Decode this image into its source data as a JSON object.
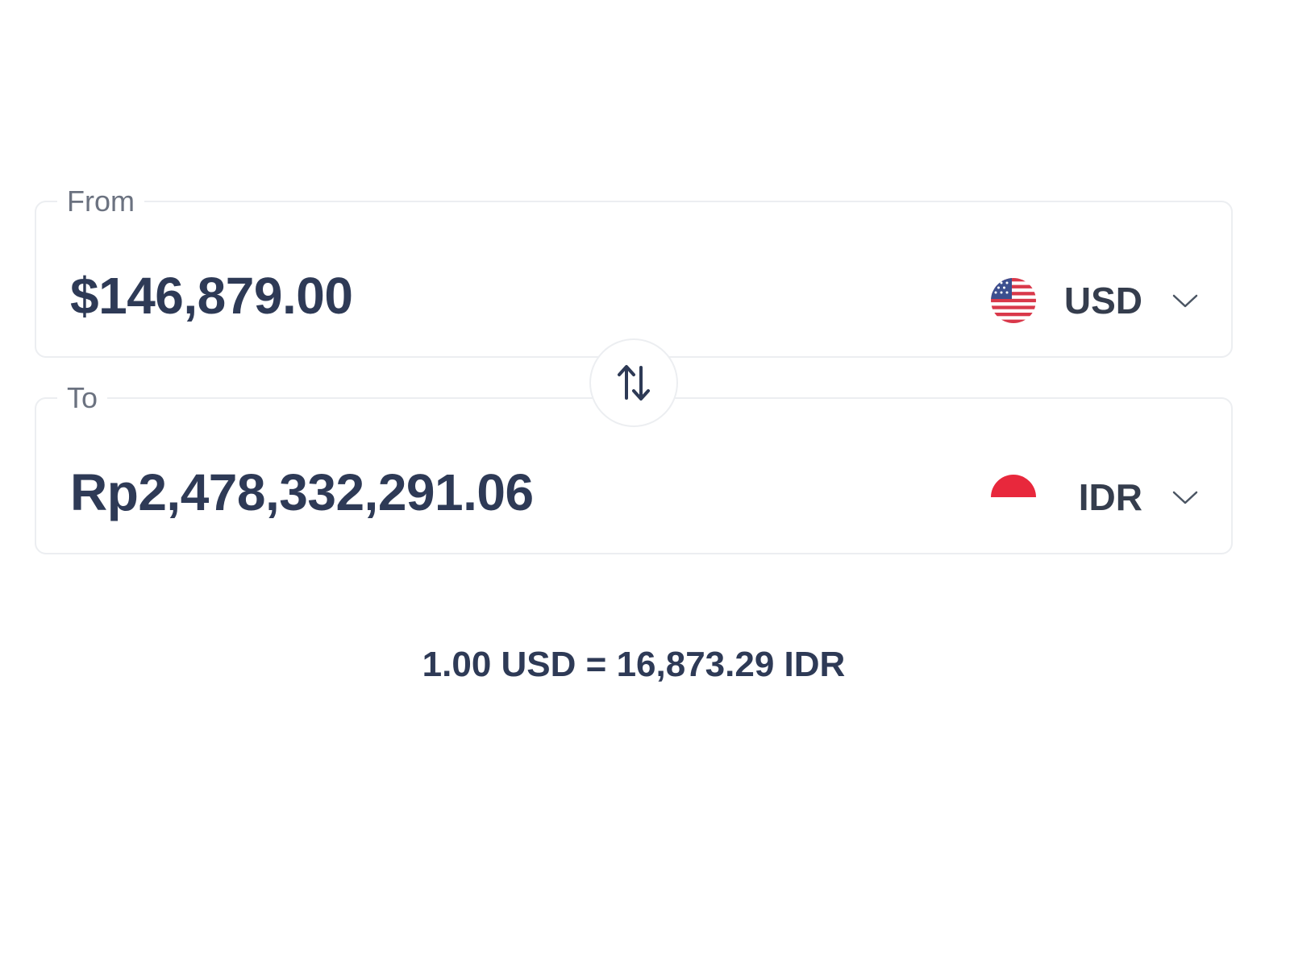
{
  "from": {
    "label": "From",
    "amount": "$146,879.00",
    "currency_code": "USD",
    "flag_icon": "us-flag-icon"
  },
  "to": {
    "label": "To",
    "amount": "Rp2,478,332,291.06",
    "currency_code": "IDR",
    "flag_icon": "indonesia-flag-icon"
  },
  "swap": {
    "icon": "swap-vertical-arrows-icon"
  },
  "rate_text": "1.00 USD = 16,873.29 IDR",
  "colors": {
    "text_primary": "#2e3a56",
    "border": "#eceef1",
    "label": "#6b7280",
    "indonesia_red": "#e8283c"
  }
}
